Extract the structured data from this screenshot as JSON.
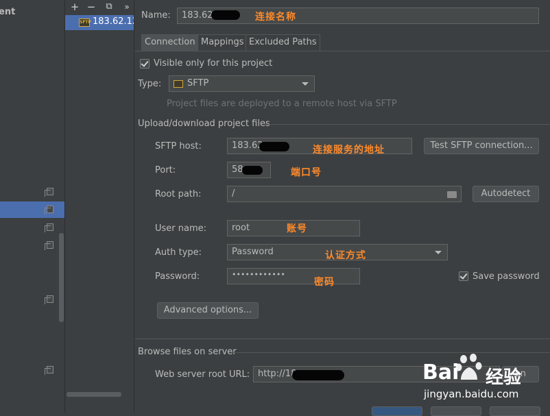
{
  "left_panel": {
    "title": "ent"
  },
  "server_list": {
    "add_label": "+",
    "remove_label": "−",
    "copy_label": "⧉",
    "more_label": "»",
    "server_name": "183.62.12",
    "sftp_badge": "SFTP"
  },
  "form": {
    "name_label": "Name:",
    "name_value": "183.62",
    "tabs": [
      "Connection",
      "Mappings",
      "Excluded Paths"
    ],
    "visible_only_label": "Visible only for this project",
    "type_label": "Type:",
    "type_value": "SFTP",
    "type_hint": "Project files are deployed to a remote host via SFTP",
    "section_upload": "Upload/download project files",
    "sftp_host_label": "SFTP host:",
    "sftp_host_value": "183.62",
    "test_button": "Test SFTP connection...",
    "port_label": "Port:",
    "port_value": "58",
    "root_path_label": "Root path:",
    "root_path_value": "/",
    "autodetect_button": "Autodetect",
    "user_name_label": "User name:",
    "user_name_value": "root",
    "auth_type_label": "Auth type:",
    "auth_type_value": "Password",
    "password_label": "Password:",
    "password_value": "••••••••••••",
    "save_password_label": "Save password",
    "advanced_button": "Advanced options...",
    "section_browse": "Browse files on server",
    "web_root_label": "Web server root URL:",
    "web_root_value": "http://18",
    "open_button": "en"
  },
  "annotations": {
    "name": "连接名称",
    "host": "连接服务的地址",
    "port": "端口号",
    "user": "账号",
    "auth": "认证方式",
    "password": "密码"
  },
  "watermark": {
    "brand_left": "Bai",
    "brand_right": "经验",
    "url": "jingyan.baidu.com"
  },
  "colors": {
    "background": "#3c3f41",
    "selection": "#4b6eaf",
    "annotation": "#ff8a2a"
  }
}
